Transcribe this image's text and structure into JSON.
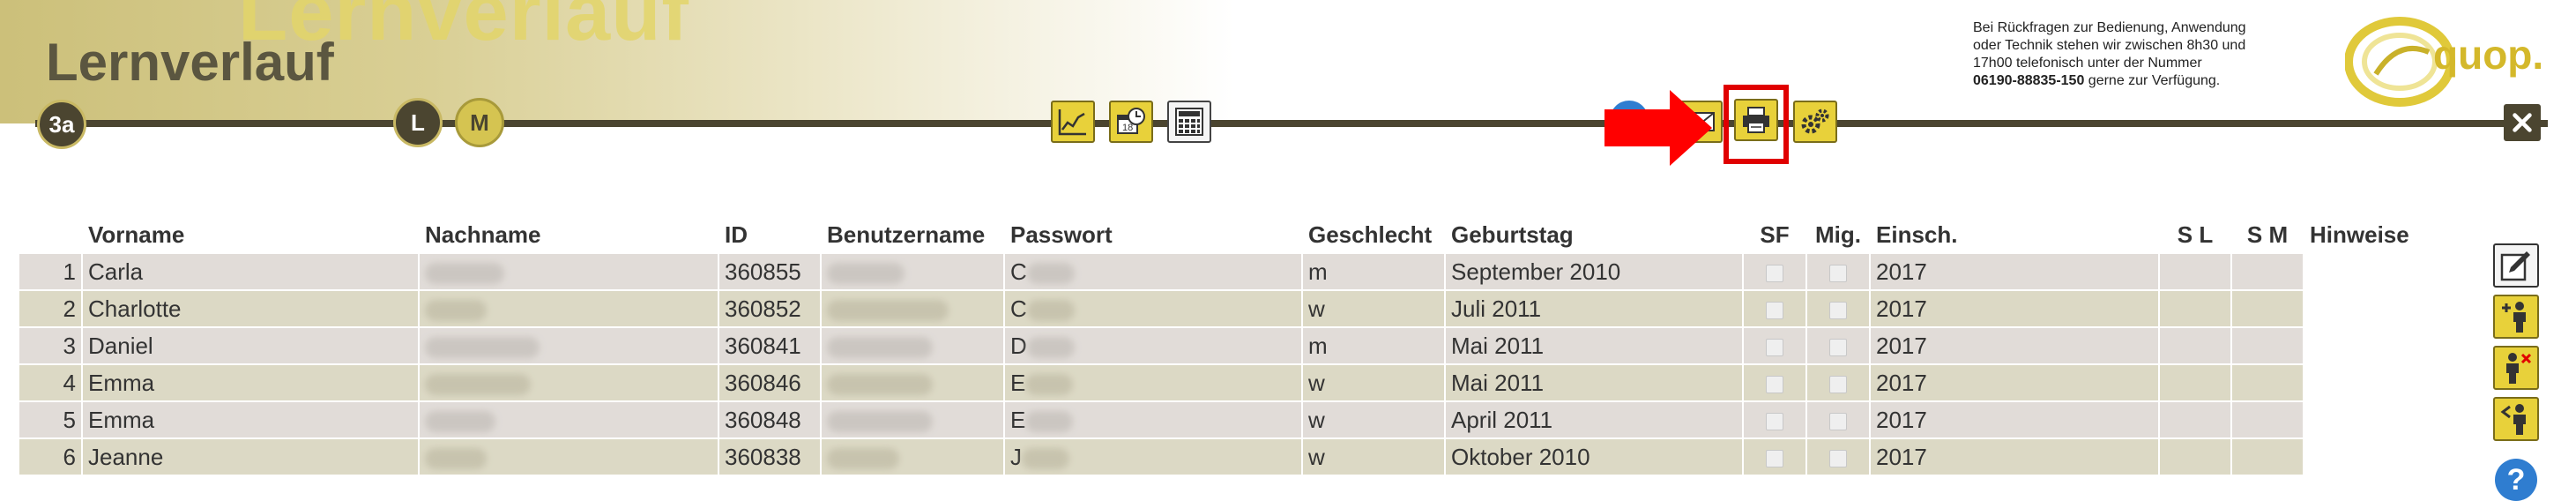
{
  "header": {
    "watermark": "Lernverlauf",
    "title": "Lernverlauf",
    "class_badge": "3a",
    "level_l": "L",
    "level_m": "M",
    "help_top": "?",
    "support": {
      "line1": "Bei Rückfragen zur Bedienung, Anwendung",
      "line2": "oder Technik stehen wir zwischen 8h30 und",
      "line3": "17h00 telefonisch unter der Nummer",
      "phone": "06190-88835-150",
      "line4": " gerne zur Verfügung."
    },
    "logo_text": "quop."
  },
  "table": {
    "headers": {
      "vorname": "Vorname",
      "nachname": "Nachname",
      "id": "ID",
      "benutzername": "Benutzername",
      "passwort": "Passwort",
      "geschlecht": "Geschlecht",
      "geburtstag": "Geburtstag",
      "sf": "SF",
      "mig": "Mig.",
      "einsch": "Einsch.",
      "sl": "S L",
      "sm": "S M",
      "hinweise": "Hinweise"
    },
    "rows": [
      {
        "nr": "1",
        "vorname": "Carla",
        "id": "360855",
        "passwort_initial": "C",
        "geschlecht": "m",
        "geburtstag": "September 2010",
        "einsch": "2017"
      },
      {
        "nr": "2",
        "vorname": "Charlotte",
        "id": "360852",
        "passwort_initial": "C",
        "geschlecht": "w",
        "geburtstag": "Juli 2011",
        "einsch": "2017"
      },
      {
        "nr": "3",
        "vorname": "Daniel",
        "id": "360841",
        "passwort_initial": "D",
        "geschlecht": "m",
        "geburtstag": "Mai 2011",
        "einsch": "2017"
      },
      {
        "nr": "4",
        "vorname": "Emma",
        "id": "360846",
        "passwort_initial": "E",
        "geschlecht": "w",
        "geburtstag": "Mai 2011",
        "einsch": "2017"
      },
      {
        "nr": "5",
        "vorname": "Emma",
        "id": "360848",
        "passwort_initial": "E",
        "geschlecht": "w",
        "geburtstag": "April 2011",
        "einsch": "2017"
      },
      {
        "nr": "6",
        "vorname": "Jeanne",
        "id": "360838",
        "passwort_initial": "J",
        "geschlecht": "w",
        "geburtstag": "Oktober 2010",
        "einsch": "2017"
      }
    ]
  },
  "side_help": "?",
  "icons": {
    "toolbar": [
      "line-chart-icon",
      "calendar-clock-icon",
      "calculator-grid-icon",
      "mail-icon",
      "printer-icon",
      "gears-icon",
      "close-icon"
    ],
    "side": [
      "edit-icon",
      "add-person-icon",
      "remove-person-icon",
      "move-person-icon",
      "help-icon"
    ]
  },
  "colors": {
    "accent_yellow": "#e8d13a",
    "dark_olive": "#4b4530",
    "highlight_red": "#e00000",
    "help_blue": "#2f7dd0"
  }
}
